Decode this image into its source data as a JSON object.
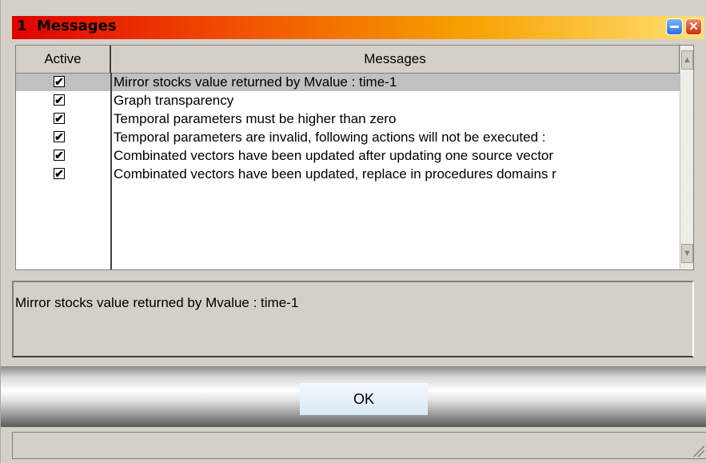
{
  "window": {
    "title": "1  Messages"
  },
  "titlebar": {
    "minimize_icon": "minimize-icon",
    "close_icon": "close-icon",
    "close_glyph": "✕"
  },
  "table": {
    "columns": [
      "Active",
      "Messages"
    ],
    "selected_row": 0,
    "check_glyph": "✔",
    "rows": [
      {
        "active": true,
        "message": "Mirror stocks value returned by Mvalue : time-1"
      },
      {
        "active": true,
        "message": "Graph transparency"
      },
      {
        "active": true,
        "message": "Temporal parameters must be higher than zero"
      },
      {
        "active": true,
        "message": "Temporal parameters are invalid, following actions will not be executed :"
      },
      {
        "active": true,
        "message": "Combinated vectors have been updated after updating one source vector"
      },
      {
        "active": true,
        "message": "Combinated vectors have been updated, replace in procedures domains r"
      }
    ],
    "scroll_up_glyph": "▲",
    "scroll_down_glyph": "▼"
  },
  "detail": {
    "text": "Mirror stocks value returned by Mvalue : time-1"
  },
  "buttons": {
    "ok_label": "OK"
  },
  "colors": {
    "title_start": "#e00000",
    "title_end": "#ffe070",
    "selection": "#c0c0c0",
    "dialog": "#d4d0c8"
  }
}
